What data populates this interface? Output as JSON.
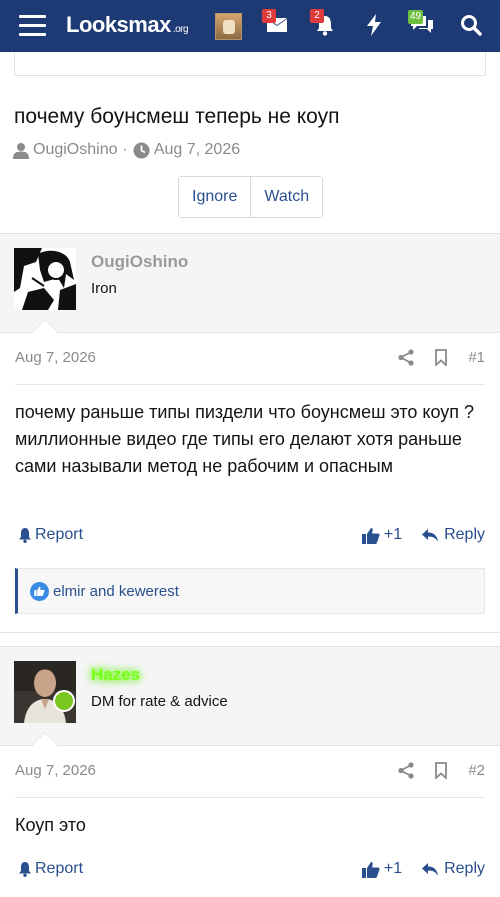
{
  "header": {
    "logo_main": "Looksmax",
    "logo_suffix": ".org",
    "alerts_badge": "3",
    "notifications_badge": "2",
    "messages_badge": "49",
    "colors": {
      "bar": "#1d3a75",
      "badge_red": "#e03b3b",
      "badge_green": "#6fbf3f"
    }
  },
  "thread": {
    "title": "почему боунсмеш теперь не коуп",
    "author": "OugiOshino",
    "date": "Aug 7, 2026",
    "ignore_label": "Ignore",
    "watch_label": "Watch"
  },
  "posts": [
    {
      "username": "OugiOshino",
      "user_title": "Iron",
      "date": "Aug 7, 2026",
      "number": "#1",
      "body": "почему раньше типы пиздели что боунсмеш это коуп ? миллионные видео где типы его делают хотя раньше сами называли метод не рабочим и опасным",
      "report_label": "Report",
      "like_count": "+1",
      "reply_label": "Reply",
      "reactions": "elmir and kewerest"
    },
    {
      "username": "Hazes",
      "user_title": "DM for rate & advice",
      "date": "Aug 7, 2026",
      "number": "#2",
      "body": "Коуп это",
      "report_label": "Report",
      "like_count": "+1",
      "reply_label": "Reply"
    }
  ]
}
